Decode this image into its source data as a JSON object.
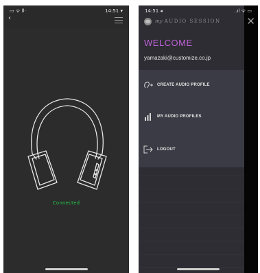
{
  "left_screen": {
    "status_left": "▭ ᯤ ll‧",
    "status_right": "14:51 ▾",
    "back_glyph": "‹",
    "connection_status": "Connected",
    "status_color": "#22c84a"
  },
  "right_screen": {
    "status_left": "14:51 ◂",
    "status_right": "..ıl ᯤ ▭",
    "app_name_prefix": "my",
    "app_name": "AUDIO SESSION",
    "close_glyph": "✕",
    "welcome": "WELCOME",
    "email": "yamazaki@customize.co.jp",
    "accent_color": "#c060d8",
    "menu": [
      {
        "label": "CREATE AUDIO PROFILE",
        "icon": "ear-plus-icon"
      },
      {
        "label": "MY AUDIO PROFILES",
        "icon": "bars-icon"
      },
      {
        "label": "LOGOUT",
        "icon": "logout-icon"
      }
    ]
  }
}
